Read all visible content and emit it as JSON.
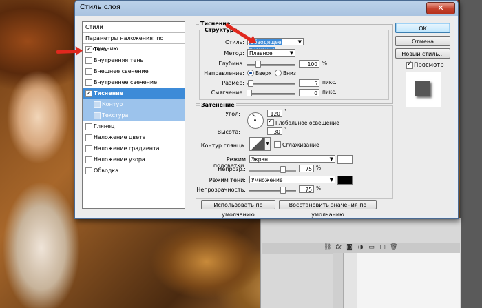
{
  "dialog": {
    "title": "Стиль слоя",
    "close_label": "✕"
  },
  "left_list": {
    "header": "Стили",
    "blend_options": "Параметры наложения: по умолчанию",
    "items": [
      {
        "label": "Тень",
        "checked": true
      },
      {
        "label": "Внутренняя тень",
        "checked": false
      },
      {
        "label": "Внешнее свечение",
        "checked": false
      },
      {
        "label": "Внутреннее свечение",
        "checked": false
      },
      {
        "label": "Тиснение",
        "checked": true
      },
      {
        "label": "Контур",
        "checked": false
      },
      {
        "label": "Текстура",
        "checked": false
      },
      {
        "label": "Глянец",
        "checked": false
      },
      {
        "label": "Наложение цвета",
        "checked": false
      },
      {
        "label": "Наложение градиента",
        "checked": false
      },
      {
        "label": "Наложение узора",
        "checked": false
      },
      {
        "label": "Обводка",
        "checked": false
      }
    ]
  },
  "bevel": {
    "section_title": "Тиснение",
    "structure_title": "Структура",
    "style_label": "Стиль:",
    "style_value": "Обводящее тиснение",
    "method_label": "Метод:",
    "method_value": "Плавное",
    "depth_label": "Глубина:",
    "depth_value": "100",
    "depth_unit": "%",
    "direction_label": "Направление:",
    "direction_up": "Вверх",
    "direction_down": "Вниз",
    "size_label": "Размер:",
    "size_value": "5",
    "size_unit": "пикс.",
    "soften_label": "Смягчение:",
    "soften_value": "0",
    "soften_unit": "пикс."
  },
  "shading": {
    "title": "Затенение",
    "angle_label": "Угол:",
    "angle_value": "120",
    "angle_unit": "°",
    "global_light_label": "Глобальное освещение",
    "altitude_label": "Высота:",
    "altitude_value": "30",
    "altitude_unit": "°",
    "gloss_label": "Контур глянца:",
    "antialias_label": "Сглаживание",
    "highlight_mode_label": "Режим подсветки:",
    "highlight_mode_value": "Экран",
    "highlight_color": "#ffffff",
    "highlight_opacity_label": "Непрозр.:",
    "highlight_opacity_value": "75",
    "highlight_opacity_unit": "%",
    "shadow_mode_label": "Режим тени:",
    "shadow_mode_value": "Умножение",
    "shadow_color": "#000000",
    "shadow_opacity_label": "Непрозрачность:",
    "shadow_opacity_value": "75",
    "shadow_opacity_unit": "%"
  },
  "bottom_buttons": {
    "make_default": "Использовать по умолчанию",
    "reset_default": "Восстановить значения по умолчанию"
  },
  "right_buttons": {
    "ok": "OK",
    "cancel": "Отмена",
    "new_style": "Новый стиль...",
    "preview_label": "Просмотр"
  },
  "panel_icons": [
    "link-icon",
    "fx-icon",
    "mask-icon",
    "adjustment-icon",
    "folder-icon",
    "new-layer-icon",
    "trash-icon"
  ],
  "colors": {
    "selection": "#3d8bd8",
    "arrow": "#e0281e"
  }
}
